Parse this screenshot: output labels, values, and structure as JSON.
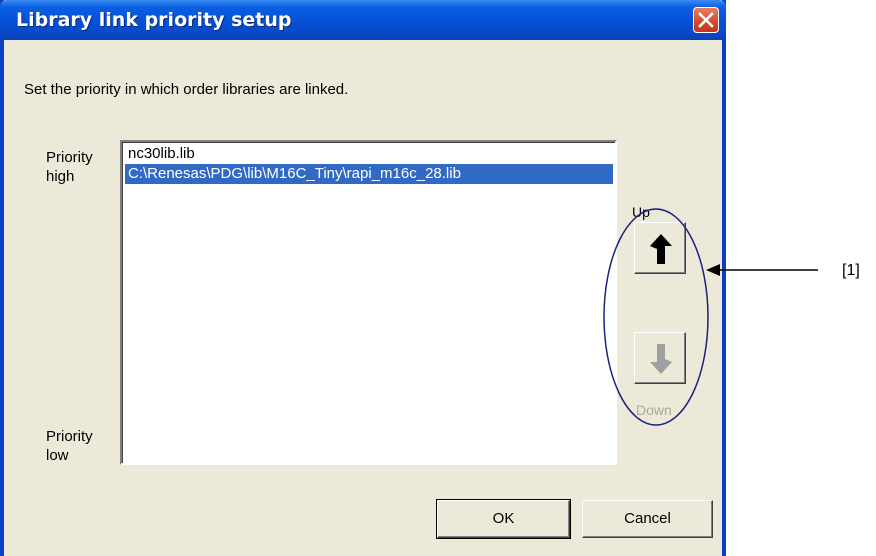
{
  "window": {
    "title": "Library link priority setup"
  },
  "instruction": "Set the priority in which order libraries are linked.",
  "priority_high": {
    "line1": "Priority",
    "line2": "high"
  },
  "priority_low": {
    "line1": "Priority",
    "line2": "low"
  },
  "libraries": [
    {
      "path": "nc30lib.lib",
      "selected": false
    },
    {
      "path": "C:\\Renesas\\PDG\\lib\\M16C_Tiny\\rapi_m16c_28.lib",
      "selected": true
    }
  ],
  "buttons": {
    "up_label": "Up",
    "down_label": "Down",
    "ok": "OK",
    "cancel": "Cancel"
  },
  "annotation": {
    "label": "[1]",
    "color": "#1a237e"
  },
  "colors": {
    "title_bar": "#0550d8",
    "selection": "#316ac5",
    "dialog_bg": "#ece9d8",
    "close": "#d4472b"
  }
}
